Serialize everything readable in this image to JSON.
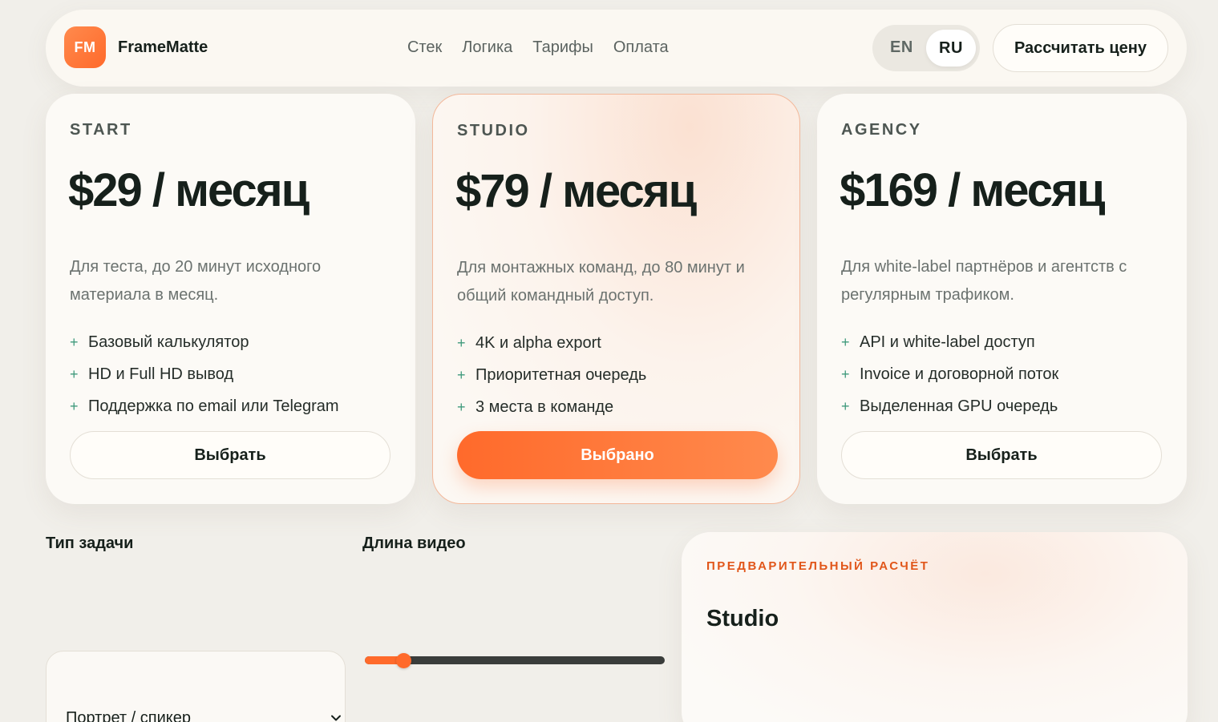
{
  "header": {
    "logo_mark": "FM",
    "brand": "FrameMatte",
    "nav": [
      "Стек",
      "Логика",
      "Тарифы",
      "Оплата"
    ],
    "lang": {
      "en": "EN",
      "ru": "RU",
      "active": "RU"
    },
    "cta": "Рассчитать цену"
  },
  "plans": [
    {
      "tier": "START",
      "price": "$29 / месяц",
      "description": "Для теста, до 20 минут исходного материала в месяц.",
      "features": [
        "Базовый калькулятор",
        "HD и Full HD вывод",
        "Поддержка по email или Telegram"
      ],
      "button": "Выбрать",
      "selected": false
    },
    {
      "tier": "STUDIO",
      "price": "$79 / месяц",
      "description": "Для монтажных команд, до 80 минут и общий командный доступ.",
      "features": [
        "4K и alpha export",
        "Приоритетная очередь",
        "3 места в команде"
      ],
      "button": "Выбрано",
      "selected": true
    },
    {
      "tier": "AGENCY",
      "price": "$169 / месяц",
      "description": "Для white-label партнёров и агентств с регулярным трафиком.",
      "features": [
        "API и white-label доступ",
        "Invoice и договорной поток",
        "Выделенная GPU очередь"
      ],
      "button": "Выбрать",
      "selected": false
    }
  ],
  "calculator": {
    "task_label": "Тип задачи",
    "task_value": "Портрет / спикер",
    "length_label": "Длина видео",
    "length_fraction": 0.11
  },
  "estimate": {
    "label": "ПРЕДВАРИТЕЛЬНЫЙ РАСЧЁТ",
    "plan": "Studio"
  },
  "colors": {
    "accent": "#ff6a2b",
    "background": "#f1efea",
    "feature_plus": "#3f9a7c"
  }
}
